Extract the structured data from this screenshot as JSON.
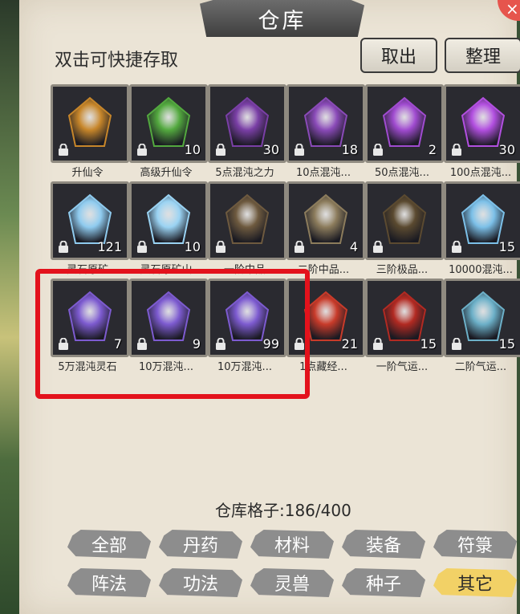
{
  "window": {
    "title": "仓库",
    "close_glyph": "×"
  },
  "hint": "双击可快捷存取",
  "buttons": {
    "take_out": "取出",
    "organize": "整理"
  },
  "capacity": "仓库格子:186/400",
  "items": [
    {
      "label": "升仙令",
      "count": "",
      "icon": "orange-token-icon",
      "color": "#c7862a"
    },
    {
      "label": "高级升仙令",
      "count": "10",
      "icon": "green-token-icon",
      "color": "#53a93f"
    },
    {
      "label": "5点混沌之力",
      "count": "30",
      "icon": "purple-crystal-icon",
      "color": "#7a3fa6"
    },
    {
      "label": "10点混沌...",
      "count": "18",
      "icon": "purple-crystal-icon",
      "color": "#8a4ab8"
    },
    {
      "label": "50点混沌...",
      "count": "2",
      "icon": "purple-flower-crystal-icon",
      "color": "#a04bd0"
    },
    {
      "label": "100点混沌...",
      "count": "30",
      "icon": "purple-flower-crystal-icon",
      "color": "#b24fe0"
    },
    {
      "label": "灵石原矿",
      "count": "121",
      "icon": "blue-crystal-icon",
      "color": "#8fcbef"
    },
    {
      "label": "灵石原矿山",
      "count": "10",
      "icon": "blue-crystal-cluster-icon",
      "color": "#9ad3f3"
    },
    {
      "label": "一阶中品",
      "count": "",
      "icon": "herb-leaf-icon",
      "color": "#6e5a3f"
    },
    {
      "label": "二阶中品...",
      "count": "4",
      "icon": "fern-leaf-icon",
      "color": "#8c7c5c"
    },
    {
      "label": "三阶极品...",
      "count": "",
      "icon": "berry-branch-icon",
      "color": "#5b4a30"
    },
    {
      "label": "10000混沌...",
      "count": "15",
      "icon": "blue-crystal-bag-icon",
      "color": "#7cc0e8"
    },
    {
      "label": "5万混沌灵石",
      "count": "7",
      "icon": "purple-crystal-bag-icon",
      "color": "#7d5bd0"
    },
    {
      "label": "10万混沌...",
      "count": "9",
      "icon": "purple-crystal-bag-icon",
      "color": "#7d5bd0"
    },
    {
      "label": "10万混沌...",
      "count": "99",
      "icon": "purple-crystal-bag-icon",
      "color": "#7d5bd0"
    },
    {
      "label": "1点藏经...",
      "count": "21",
      "icon": "treasure-chest-icon",
      "color": "#c83b2a"
    },
    {
      "label": "一阶气运...",
      "count": "15",
      "icon": "red-gold-chest-icon",
      "color": "#b22a22"
    },
    {
      "label": "二阶气运...",
      "count": "15",
      "icon": "blue-chest-icon",
      "color": "#6cb0c8"
    }
  ],
  "tabs": [
    "全部",
    "丹药",
    "材料",
    "装备",
    "符箓",
    "阵法",
    "功法",
    "灵兽",
    "种子",
    "其它"
  ],
  "active_tab": "其它"
}
